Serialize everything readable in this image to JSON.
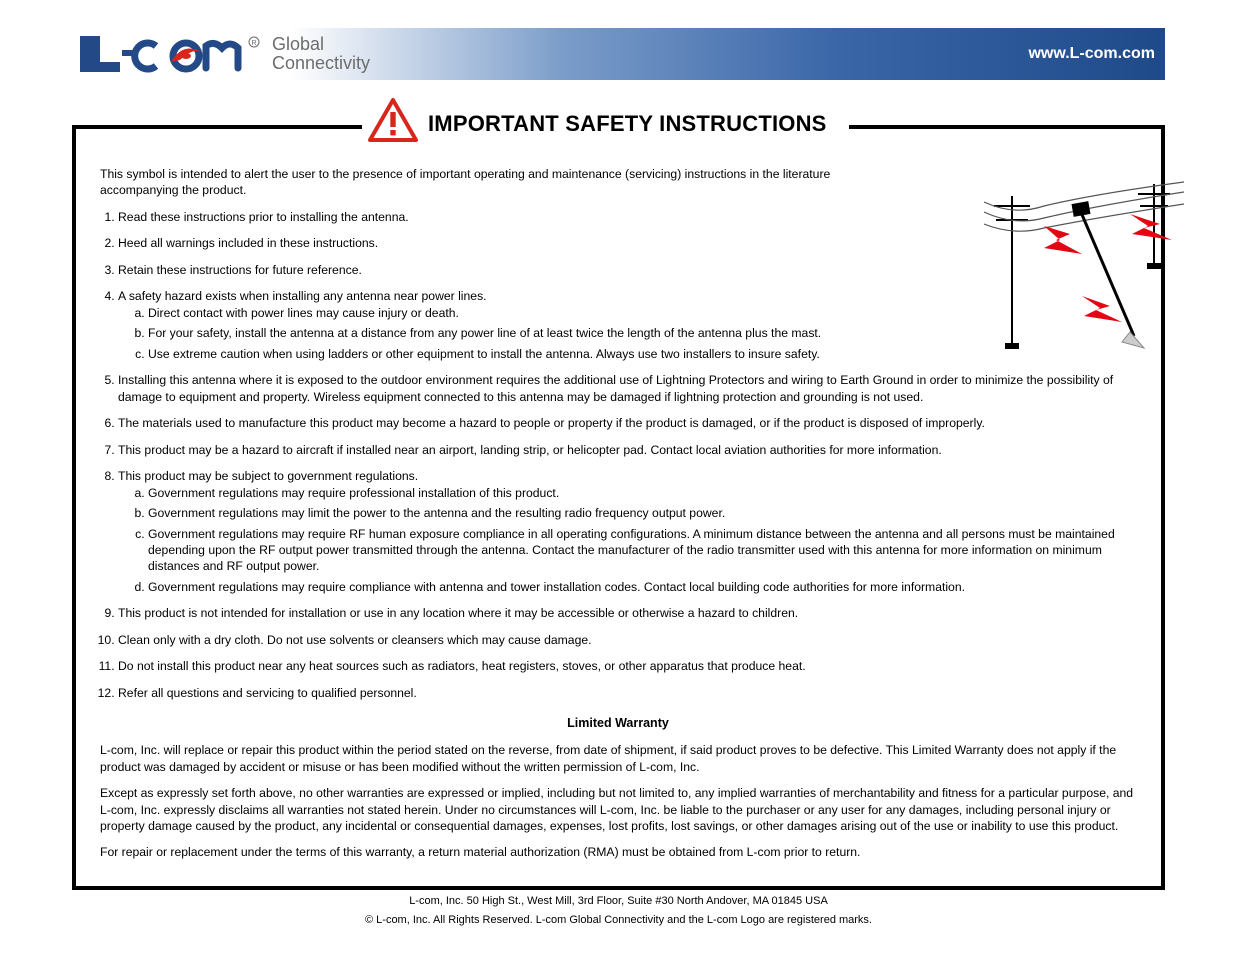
{
  "header": {
    "tagline1": "Global",
    "tagline2": "Connectivity",
    "url": "www.L-com.com"
  },
  "caution": {
    "label": "IMPORTANT SAFETY INSTRUCTIONS"
  },
  "content": {
    "intro": "This symbol is intended to alert the user to the presence of important operating and maintenance (servicing) instructions in the literature accompanying the product.",
    "items": {
      "1": "Read these instructions prior to installing the antenna.",
      "2": "Heed all warnings included in these instructions.",
      "3": "Retain these instructions for future reference.",
      "4_lead": "A safety hazard exists when installing any antenna near power lines.",
      "4_a": "Direct contact with power lines may cause injury or death.",
      "4_b": "For your safety, install the antenna at a distance from any power line of at least twice the length of the antenna plus the mast.",
      "4_c": "Use extreme caution when using ladders or other equipment to install the antenna. Always use two installers to insure safety.",
      "5": "Installing this antenna where it is exposed to the outdoor environment requires the additional use of Lightning Protectors and wiring to Earth Ground in order to minimize the possibility of damage to equipment and property. Wireless equipment connected to this antenna may be damaged if lightning protection and grounding is not used.",
      "6": "The materials used to manufacture this product may become a hazard to people or property if the product is damaged, or if the product is disposed of improperly.",
      "7": "This product may be a hazard to aircraft if installed near an airport, landing strip, or helicopter pad. Contact local aviation authorities for more information.",
      "8_lead": "This product may be subject to government regulations.",
      "8_a": "Government regulations may require professional installation of this product.",
      "8_b": "Government regulations may limit the power to the antenna and the resulting radio frequency output power.",
      "8_c": "Government regulations may require RF human exposure compliance in all operating configurations. A minimum distance between the antenna and all persons must be maintained depending upon the RF output power transmitted through the antenna. Contact the manufacturer of the radio transmitter used with this antenna for more information on minimum distances and RF output power.",
      "8_d": "Government regulations may require compliance with antenna and tower installation codes. Contact local building code authorities for more information.",
      "9": "This product is not intended for installation or use in any location where it may be accessible or otherwise a hazard to children.",
      "10": "Clean only with a dry cloth. Do not use solvents or cleansers which may cause damage.",
      "11": "Do not install this product near any heat sources such as radiators, heat registers, stoves, or other apparatus that produce heat.",
      "12": "Refer all questions and servicing to qualified personnel."
    },
    "warranty_title": "Limited Warranty",
    "warranty_p1": "L-com, Inc. will replace or repair this product within the period stated on the reverse, from date of shipment, if said product proves to be defective. This Limited Warranty does not apply if the product was damaged by accident or misuse or has been modified without the written permission of L-com, Inc.",
    "warranty_p2": "Except as expressly set forth above, no other warranties are expressed or implied, including but not limited to, any implied warranties of merchantability and fitness for a particular purpose, and L-com, Inc. expressly disclaims all warranties not stated herein. Under no circumstances will L-com, Inc. be liable to the purchaser or any user for any damages, including personal injury or property damage caused by the product, any incidental or consequential damages, expenses, lost profits, lost savings, or other damages arising out of the use or inability to use this product.",
    "warranty_p3": "For repair or replacement under the terms of this warranty, a return material authorization (RMA) must be obtained from L-com prior to return."
  },
  "footer": {
    "address": "L-com, Inc. 50 High St., West Mill, 3rd Floor, Suite #30 North Andover, MA 01845 USA",
    "copyright": "© L-com, Inc. All Rights Reserved. L-com Global Connectivity and the L-com Logo are registered marks."
  }
}
